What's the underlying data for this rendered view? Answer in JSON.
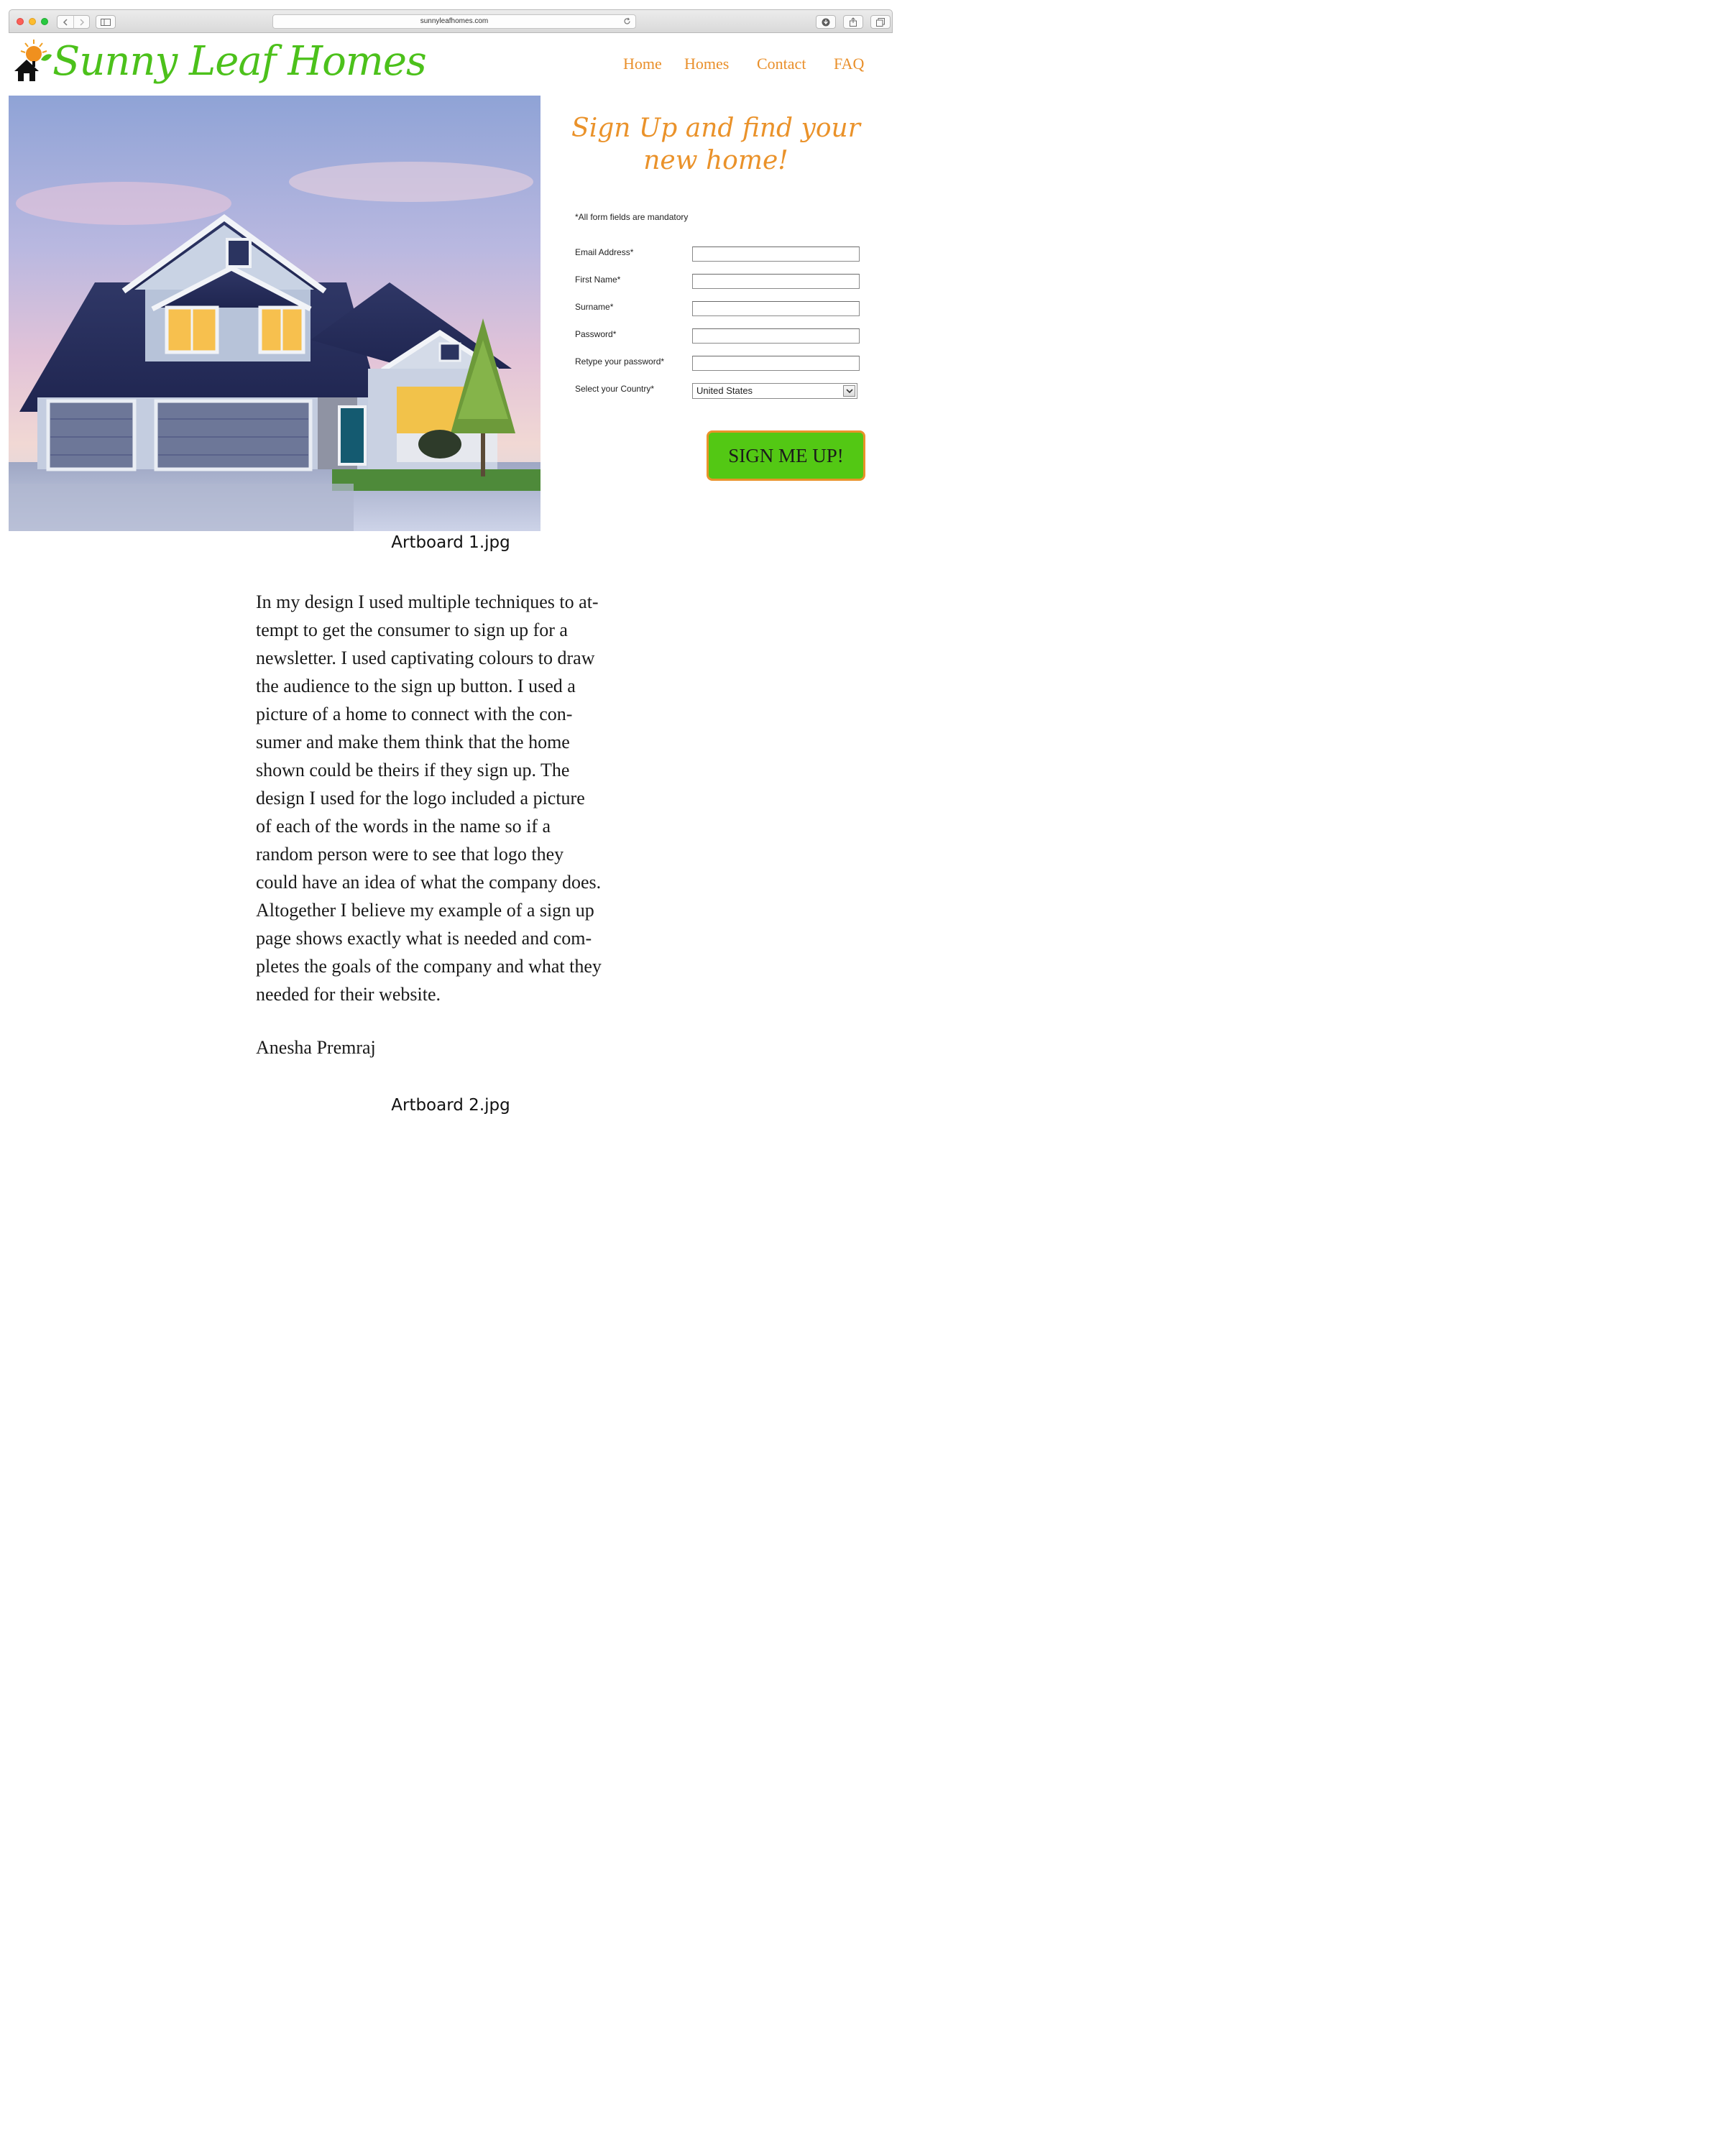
{
  "browser": {
    "url": "sunnyleafhomes.com",
    "icons": [
      "close-dot",
      "minimize-dot",
      "zoom-dot",
      "back-chevron-icon",
      "forward-chevron-icon",
      "sidebar-icon",
      "reload-icon",
      "download-icon",
      "share-icon",
      "tabs-icon"
    ]
  },
  "site": {
    "brand": "Sunny Leaf Homes",
    "nav": [
      "Home",
      "Homes",
      "Contact",
      "FAQ"
    ],
    "headline": "Sign Up and find your new home!"
  },
  "form": {
    "note": "*All form fields are mandatory",
    "fields": [
      {
        "label": "Email Address*",
        "value": ""
      },
      {
        "label": "First Name*",
        "value": ""
      },
      {
        "label": "Surname*",
        "value": ""
      },
      {
        "label": "Password*",
        "value": ""
      },
      {
        "label": "Retype your password*",
        "value": ""
      }
    ],
    "country_label": "Select your Country*",
    "country_value": "United States",
    "submit": "SIGN ME UP!"
  },
  "captions": {
    "artboard1": "Artboard 1.jpg",
    "artboard2": "Artboard 2.jpg"
  },
  "essay": {
    "lines": [
      "In my design I used multiple techniques to at-",
      "tempt to get the consumer to sign up for a",
      "newsletter. I used captivating colours to draw",
      "the audience to the sign up button. I used a",
      "picture of a home to connect with the con-",
      "sumer and make them think that the home",
      "shown could be theirs if they sign up. The",
      "design I used for the logo included a picture",
      "of each of the words in the name so if a",
      "random person were to see that logo they",
      "could have an idea of what the company does.",
      "Altogether I believe my example of a sign up",
      "page shows exactly what is needed and com-",
      "pletes the goals of the company and what they",
      "needed for their website."
    ],
    "author": "Anesha Premraj"
  },
  "colors": {
    "brand_green": "#4cc11b",
    "accent_orange": "#ea922a",
    "button_green": "#53c814"
  }
}
